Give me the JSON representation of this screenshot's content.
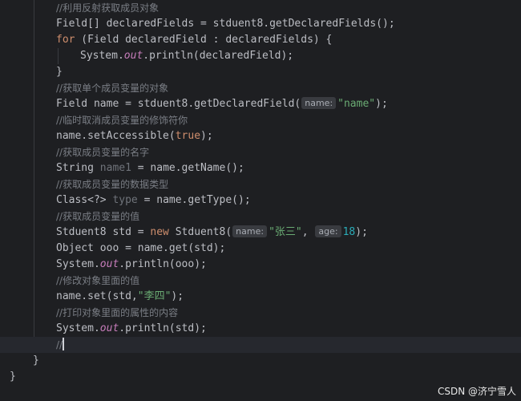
{
  "code_lines": [
    [
      [
        "comment",
        "//利用反射获取成员对象"
      ]
    ],
    [
      [
        "plain",
        "Field[] declaredFields = stduent8.getDeclaredFields();"
      ]
    ],
    [
      [
        "kw",
        "for"
      ],
      [
        "plain",
        " (Field declaredField : declaredFields) {"
      ]
    ],
    [
      [
        "plain",
        "System."
      ],
      [
        "field",
        "out"
      ],
      [
        "plain",
        ".println(declaredField);"
      ]
    ],
    [
      [
        "plain",
        "}"
      ]
    ],
    [
      [
        "comment",
        "//获取单个成员变量的对象"
      ]
    ],
    [
      [
        "plain",
        "Field name = stduent8.getDeclaredField("
      ],
      [
        "hint",
        "name:"
      ],
      [
        "str",
        "\"name\""
      ],
      [
        "plain",
        ");"
      ]
    ],
    [
      [
        "comment",
        "//临时取消成员变量的修饰符你"
      ]
    ],
    [
      [
        "plain",
        "name.setAccessible("
      ],
      [
        "kw",
        "true"
      ],
      [
        "plain",
        ");"
      ]
    ],
    [
      [
        "comment",
        "//获取成员变量的名字"
      ]
    ],
    [
      [
        "plain",
        "String "
      ],
      [
        "fade",
        "name1"
      ],
      [
        "plain",
        " = name.getName();"
      ]
    ],
    [
      [
        "comment",
        "//获取成员变量的数据类型"
      ]
    ],
    [
      [
        "plain",
        "Class<?> "
      ],
      [
        "fade",
        "type"
      ],
      [
        "plain",
        " = name.getType();"
      ]
    ],
    [
      [
        "comment",
        "//获取成员变量的值"
      ]
    ],
    [
      [
        "plain",
        "Stduent8 std = "
      ],
      [
        "kw",
        "new"
      ],
      [
        "plain",
        " Stduent8("
      ],
      [
        "hint",
        "name:"
      ],
      [
        "str",
        "\"张三\""
      ],
      [
        "plain",
        ", "
      ],
      [
        "hint",
        "age:"
      ],
      [
        "num",
        "18"
      ],
      [
        "plain",
        ");"
      ]
    ],
    [
      [
        "plain",
        "Object ooo = name.get(std);"
      ]
    ],
    [
      [
        "plain",
        "System."
      ],
      [
        "field",
        "out"
      ],
      [
        "plain",
        ".println(ooo);"
      ]
    ],
    [
      [
        "comment",
        "//修改对象里面的值"
      ]
    ],
    [
      [
        "plain",
        "name.set(std,"
      ],
      [
        "str",
        "\"李四\""
      ],
      [
        "plain",
        ");"
      ]
    ],
    [
      [
        "comment",
        "//打印对象里面的属性的内容"
      ]
    ],
    [
      [
        "plain",
        "System."
      ],
      [
        "field",
        "out"
      ],
      [
        "plain",
        ".println(std);"
      ]
    ],
    [
      [
        "comment",
        "//"
      ],
      [
        "caret",
        ""
      ]
    ],
    [
      [
        "plain",
        "}"
      ]
    ],
    [
      [
        "plain",
        "}"
      ]
    ]
  ],
  "watermark": "CSDN @济宁雪人"
}
